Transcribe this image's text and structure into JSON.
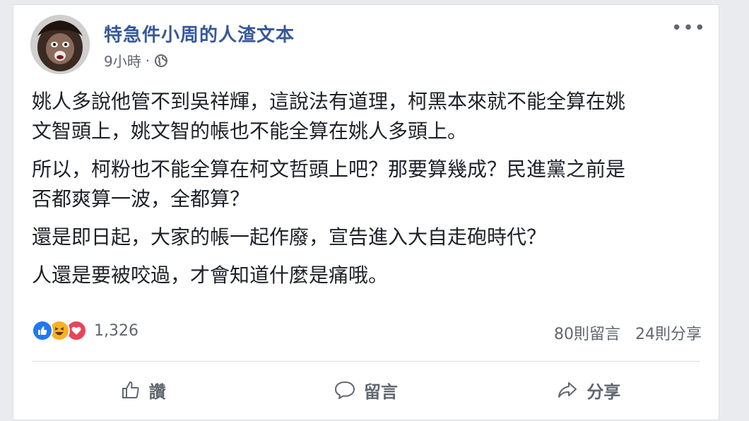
{
  "post": {
    "author": "特急件小周的人渣文本",
    "time": "9小時",
    "time_separator": "·",
    "privacy_icon": "globe-icon",
    "more_label": "•••",
    "paragraphs": [
      "姚人多說他管不到吳祥輝，這說法有道理，柯黑本來就不能全算在姚\n文智頭上，姚文智的帳也不能全算在姚人多頭上。",
      "所以，柯粉也不能全算在柯文哲頭上吧？那要算幾成？民進黨之前是\n否都爽算一波，全都算？",
      "還是即日起，大家的帳一起作廢，宣告進入大自走砲時代？",
      "人還是要被咬過，才會知道什麼是痛哦。"
    ]
  },
  "reactions": {
    "icons": [
      "like-icon",
      "haha-icon",
      "love-icon"
    ],
    "count": "1,326"
  },
  "stats": {
    "comments": "80則留言",
    "shares": "24則分享"
  },
  "actions": {
    "like_label": "讚",
    "comment_label": "留言",
    "share_label": "分享"
  },
  "colors": {
    "author": "#365899",
    "like": "#2078f4",
    "haha": "#f7b125",
    "love": "#e9445a",
    "muted": "#606770"
  }
}
